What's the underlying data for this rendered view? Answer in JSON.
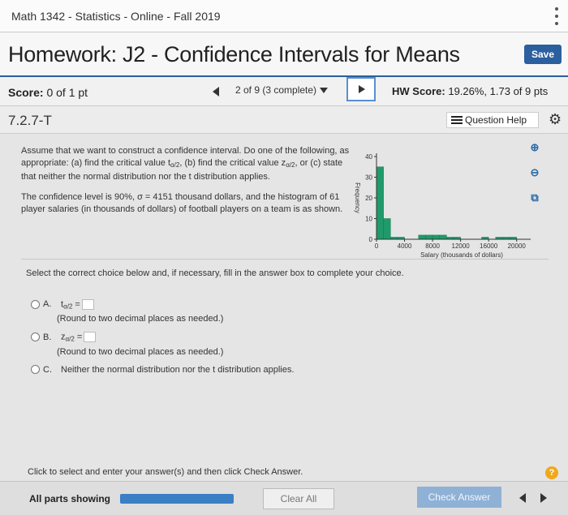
{
  "course": {
    "title": "Math 1342 - Statistics - Online - Fall 2019"
  },
  "header": {
    "title": "Homework: J2 - Confidence Intervals for Means",
    "save_label": "Save"
  },
  "score_bar": {
    "score_label": "Score:",
    "score_value": " 0 of 1 pt",
    "progress": "2 of 9 (3 complete)",
    "hw_score_label": "HW Score:",
    "hw_score_value": " 19.26%, 1.73 of 9 pts"
  },
  "question": {
    "id": "7.2.7-T",
    "help_label": "Question Help",
    "text_part1": "Assume that we want to construct a confidence interval. Do one of the following, as appropriate: (a) find the critical value t",
    "text_sub1": "α/2",
    "text_part2": ", (b) find the critical value z",
    "text_sub2": "α/2",
    "text_part3": ", or (c) state that neither the normal distribution nor the t distribution applies.",
    "text_para2": "The confidence level is 90%, σ = 4151 thousand dollars, and the histogram of 61 player salaries (in thousands of dollars) of football players on a team is as shown."
  },
  "chart_data": {
    "type": "bar",
    "title": "",
    "xlabel": "Salary (thousands of dollars)",
    "ylabel": "Frequency",
    "x_ticks": [
      0,
      4000,
      8000,
      12000,
      16000,
      20000
    ],
    "y_ticks": [
      0,
      10,
      20,
      30,
      40
    ],
    "xlim": [
      0,
      22000
    ],
    "ylim": [
      0,
      40
    ],
    "bin_width": 1000,
    "bins": [
      {
        "start": 0,
        "value": 35
      },
      {
        "start": 1000,
        "value": 10
      },
      {
        "start": 2000,
        "value": 1
      },
      {
        "start": 3000,
        "value": 1
      },
      {
        "start": 6000,
        "value": 2
      },
      {
        "start": 7000,
        "value": 2
      },
      {
        "start": 8000,
        "value": 2
      },
      {
        "start": 9000,
        "value": 2
      },
      {
        "start": 10000,
        "value": 1
      },
      {
        "start": 11000,
        "value": 1
      },
      {
        "start": 15000,
        "value": 1
      },
      {
        "start": 17000,
        "value": 1
      },
      {
        "start": 18000,
        "value": 1
      },
      {
        "start": 19000,
        "value": 1
      }
    ],
    "bar_color": "#1f9a6b"
  },
  "tools": {
    "zoom_in": "zoom-in-icon",
    "zoom_out": "zoom-out-icon",
    "popout": "external-link-icon"
  },
  "instruction": "Select the correct choice below and, if necessary, fill in the answer box to complete your choice.",
  "choices": [
    {
      "letter": "A.",
      "var": "t",
      "sub": "α/2",
      "eq": " =",
      "hint": "(Round to two decimal places as needed.)"
    },
    {
      "letter": "B.",
      "var": "z",
      "sub": "α/2",
      "eq": " =",
      "hint": "(Round to two decimal places as needed.)"
    },
    {
      "letter": "C.",
      "text": "Neither the normal distribution nor the t distribution applies."
    }
  ],
  "footer": {
    "message": "Click to select and enter your answer(s) and then click Check Answer.",
    "help_mark": "?",
    "parts_label": "All parts showing",
    "clear_label": "Clear All",
    "check_label": "Check Answer"
  }
}
